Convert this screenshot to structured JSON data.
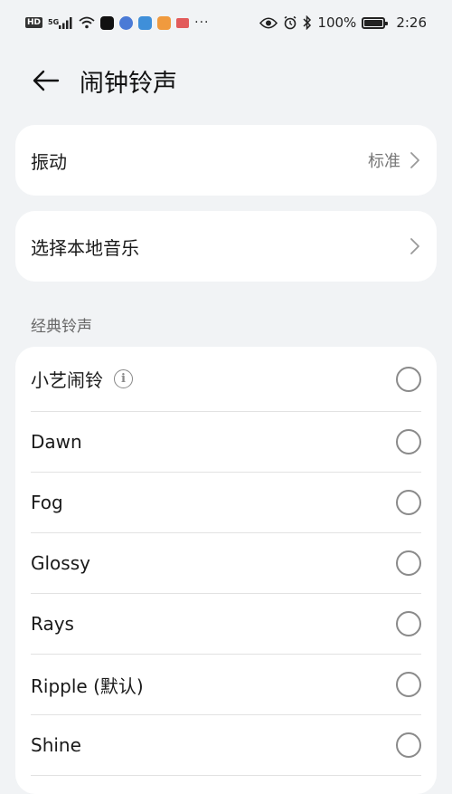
{
  "status_bar": {
    "hd_label": "HD",
    "signal_label": "5G",
    "battery_text": "100%",
    "time": "2:26",
    "more_dots": "···"
  },
  "header": {
    "title": "闹钟铃声"
  },
  "vibration": {
    "label": "振动",
    "value": "标准"
  },
  "local_music": {
    "label": "选择本地音乐"
  },
  "classic": {
    "section_title": "经典铃声",
    "items": [
      {
        "label": "小艺闹铃",
        "has_info": true
      },
      {
        "label": "Dawn"
      },
      {
        "label": "Fog"
      },
      {
        "label": "Glossy"
      },
      {
        "label": "Rays"
      },
      {
        "label": "Ripple (默认)"
      },
      {
        "label": "Shine"
      }
    ]
  },
  "colors": {
    "background": "#f1f3f5",
    "card": "#ffffff",
    "secondary_text": "#777777"
  }
}
